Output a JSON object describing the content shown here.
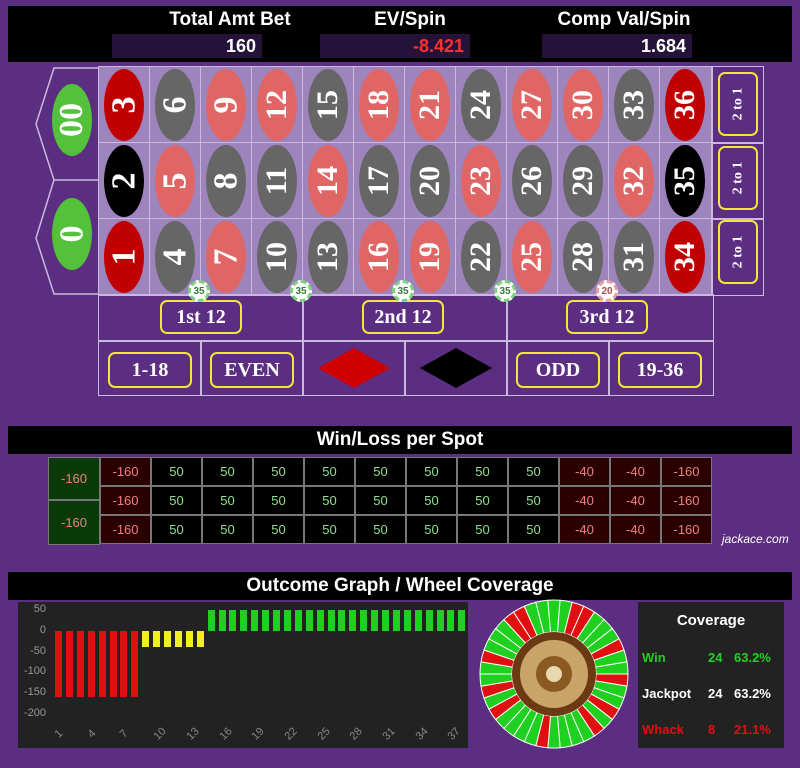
{
  "header": {
    "total_amt_bet": {
      "label": "Total Amt Bet",
      "value": "160"
    },
    "ev_spin": {
      "label": "EV/Spin",
      "value": "-8.421"
    },
    "comp_val_spin": {
      "label": "Comp Val/Spin",
      "value": "1.684"
    }
  },
  "board": {
    "zeros": [
      "00",
      "0"
    ],
    "rows": [
      [
        {
          "n": "3",
          "c": "red"
        },
        {
          "n": "6",
          "c": "gry"
        },
        {
          "n": "9",
          "c": "lred"
        },
        {
          "n": "12",
          "c": "lred"
        },
        {
          "n": "15",
          "c": "gry"
        },
        {
          "n": "18",
          "c": "lred"
        },
        {
          "n": "21",
          "c": "lred"
        },
        {
          "n": "24",
          "c": "gry"
        },
        {
          "n": "27",
          "c": "lred"
        },
        {
          "n": "30",
          "c": "lred"
        },
        {
          "n": "33",
          "c": "gry"
        },
        {
          "n": "36",
          "c": "red"
        }
      ],
      [
        {
          "n": "2",
          "c": "blk"
        },
        {
          "n": "5",
          "c": "lred"
        },
        {
          "n": "8",
          "c": "gry"
        },
        {
          "n": "11",
          "c": "gry"
        },
        {
          "n": "14",
          "c": "lred"
        },
        {
          "n": "17",
          "c": "gry"
        },
        {
          "n": "20",
          "c": "gry"
        },
        {
          "n": "23",
          "c": "lred"
        },
        {
          "n": "26",
          "c": "gry"
        },
        {
          "n": "29",
          "c": "gry"
        },
        {
          "n": "32",
          "c": "lred"
        },
        {
          "n": "35",
          "c": "blk"
        }
      ],
      [
        {
          "n": "1",
          "c": "red"
        },
        {
          "n": "4",
          "c": "gry"
        },
        {
          "n": "7",
          "c": "lred"
        },
        {
          "n": "10",
          "c": "gry"
        },
        {
          "n": "13",
          "c": "gry"
        },
        {
          "n": "16",
          "c": "lred"
        },
        {
          "n": "19",
          "c": "lred"
        },
        {
          "n": "22",
          "c": "gry"
        },
        {
          "n": "25",
          "c": "lred"
        },
        {
          "n": "28",
          "c": "gry"
        },
        {
          "n": "31",
          "c": "gry"
        },
        {
          "n": "34",
          "c": "red"
        }
      ]
    ],
    "columns": [
      "2 to 1",
      "2 to 1",
      "2 to 1"
    ],
    "dozens": [
      "1st 12",
      "2nd 12",
      "3rd 12"
    ],
    "outside": {
      "low": "1-18",
      "even": "EVEN",
      "odd": "ODD",
      "high": "19-36"
    },
    "chips": [
      "35",
      "35",
      "35",
      "35",
      "20"
    ]
  },
  "winloss": {
    "title": "Win/Loss per Spot",
    "zeros": [
      "-160",
      "-160"
    ],
    "rows": [
      [
        "-160",
        "50",
        "50",
        "50",
        "50",
        "50",
        "50",
        "50",
        "50",
        "-40",
        "-40",
        "-160"
      ],
      [
        "-160",
        "50",
        "50",
        "50",
        "50",
        "50",
        "50",
        "50",
        "50",
        "-40",
        "-40",
        "-160"
      ],
      [
        "-160",
        "50",
        "50",
        "50",
        "50",
        "50",
        "50",
        "50",
        "50",
        "-40",
        "-40",
        "-160"
      ]
    ],
    "brand": "jackace.com"
  },
  "outcome": {
    "title": "Outcome Graph / Wheel Coverage",
    "y_ticks": [
      "50",
      "0",
      "-50",
      "-100",
      "-150",
      "-200"
    ],
    "x_ticks": [
      "1",
      "4",
      "7",
      "10",
      "13",
      "16",
      "19",
      "22",
      "25",
      "28",
      "31",
      "34",
      "37"
    ]
  },
  "chart_data": {
    "type": "bar",
    "categories": [
      "1",
      "2",
      "3",
      "4",
      "5",
      "6",
      "7",
      "8",
      "9",
      "10",
      "11",
      "12",
      "13",
      "14",
      "15",
      "16",
      "17",
      "18",
      "19",
      "20",
      "21",
      "22",
      "23",
      "24",
      "25",
      "26",
      "27",
      "28",
      "29",
      "30",
      "31",
      "32",
      "33",
      "34",
      "35",
      "36",
      "37",
      "38"
    ],
    "values": [
      -160,
      -160,
      -160,
      -160,
      -160,
      -160,
      -160,
      -160,
      -40,
      -40,
      -40,
      -40,
      -40,
      -40,
      50,
      50,
      50,
      50,
      50,
      50,
      50,
      50,
      50,
      50,
      50,
      50,
      50,
      50,
      50,
      50,
      50,
      50,
      50,
      50,
      50,
      50,
      50,
      50
    ],
    "ylim": [
      -200,
      50
    ],
    "colors": {
      "loss": "#e01010",
      "partial": "#f0f020",
      "win": "#20d020"
    }
  },
  "coverage": {
    "title": "Coverage",
    "rows": [
      {
        "label": "Win",
        "count": "24",
        "pct": "63.2%",
        "color": "#20d020"
      },
      {
        "label": "Jackpot",
        "count": "24",
        "pct": "63.2%",
        "color": "#ffffff"
      },
      {
        "label": "Whack",
        "count": "8",
        "pct": "21.1%",
        "color": "#e01010"
      }
    ]
  }
}
